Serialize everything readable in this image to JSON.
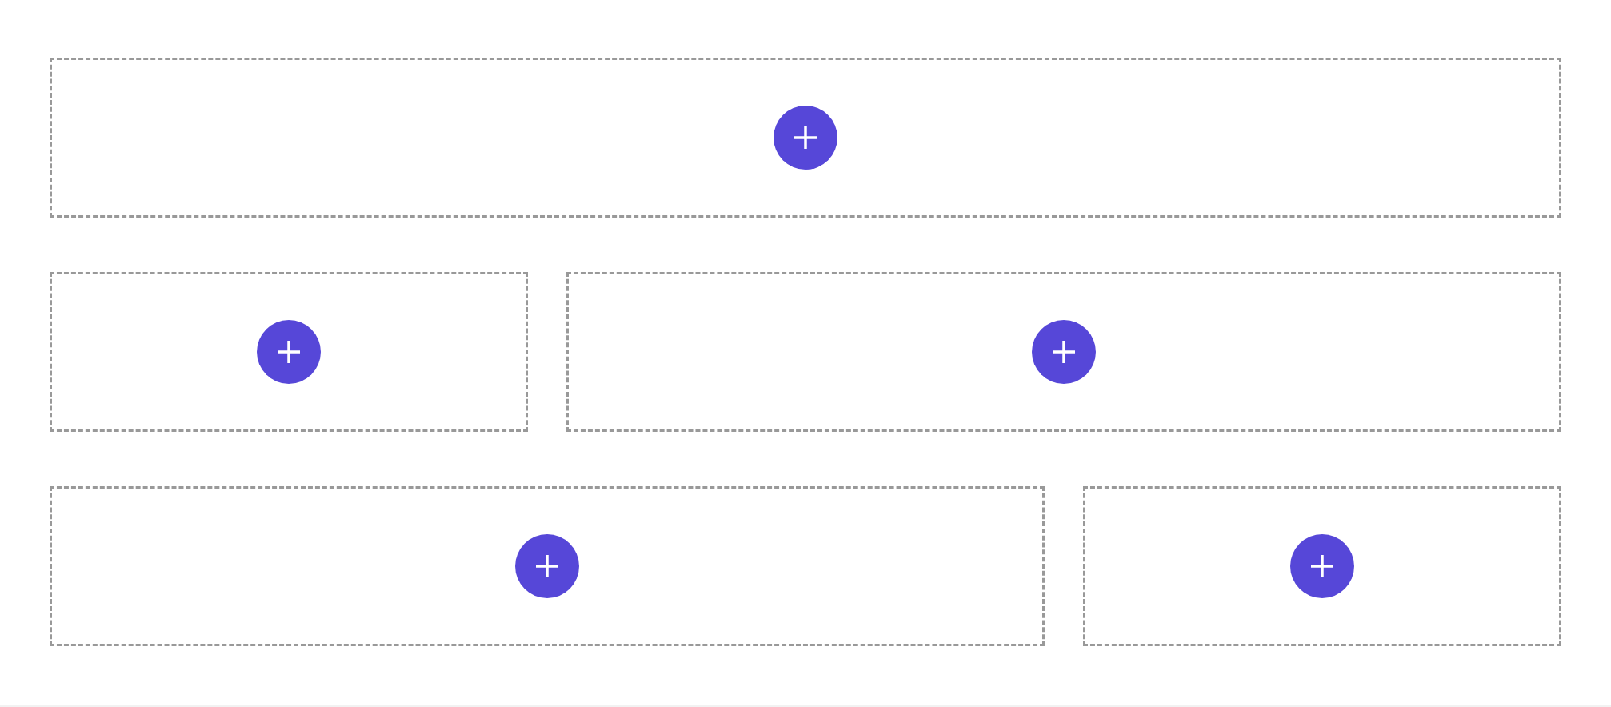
{
  "rows": [
    {
      "slots": [
        {
          "kind": "full"
        }
      ]
    },
    {
      "slots": [
        {
          "kind": "narrow"
        },
        {
          "kind": "wide"
        }
      ]
    },
    {
      "slots": [
        {
          "kind": "wide"
        },
        {
          "kind": "narrow"
        }
      ]
    }
  ]
}
